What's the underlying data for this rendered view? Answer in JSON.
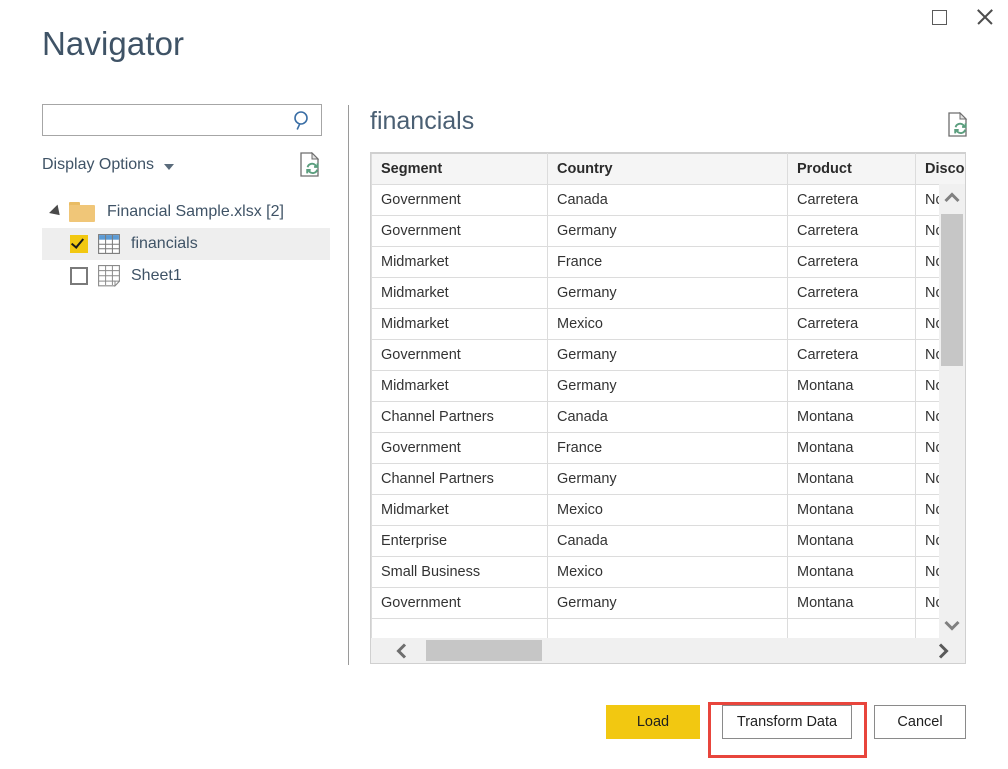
{
  "window": {
    "title": "Navigator",
    "maximize_label": "Maximize",
    "close_label": "Close"
  },
  "sidebar": {
    "search": {
      "value": "",
      "placeholder": "",
      "icon": "search-icon"
    },
    "display_options": {
      "label": "Display Options",
      "caret_icon": "chevron-down-icon"
    },
    "refresh_icon": "refresh-document-icon",
    "tree": [
      {
        "type": "folder",
        "label": "Financial Sample.xlsx [2]",
        "expanded": true,
        "icon": "folder-icon",
        "expander_icon": "expander-triangle-icon"
      },
      {
        "type": "table",
        "label": "financials",
        "checked": true,
        "selected": true,
        "icon": "table-icon",
        "checkbox_icon": "checkbox-checked-icon"
      },
      {
        "type": "sheet",
        "label": "Sheet1",
        "checked": false,
        "selected": false,
        "icon": "sheet-icon",
        "checkbox_icon": "checkbox-unchecked-icon"
      }
    ]
  },
  "preview": {
    "title": "financials",
    "refresh_icon": "refresh-document-icon",
    "columns": [
      "Segment",
      "Country",
      "Product",
      "Discou"
    ],
    "rows": [
      [
        "Government",
        "Canada",
        "Carretera",
        "Nc"
      ],
      [
        "Government",
        "Germany",
        "Carretera",
        "Nc"
      ],
      [
        "Midmarket",
        "France",
        "Carretera",
        "Nc"
      ],
      [
        "Midmarket",
        "Germany",
        "Carretera",
        "Nc"
      ],
      [
        "Midmarket",
        "Mexico",
        "Carretera",
        "Nc"
      ],
      [
        "Government",
        "Germany",
        "Carretera",
        "Nc"
      ],
      [
        "Midmarket",
        "Germany",
        "Montana",
        "Nc"
      ],
      [
        "Channel Partners",
        "Canada",
        "Montana",
        "Nc"
      ],
      [
        "Government",
        "France",
        "Montana",
        "Nc"
      ],
      [
        "Channel Partners",
        "Germany",
        "Montana",
        "Nc"
      ],
      [
        "Midmarket",
        "Mexico",
        "Montana",
        "Nc"
      ],
      [
        "Enterprise",
        "Canada",
        "Montana",
        "Nc"
      ],
      [
        "Small Business",
        "Mexico",
        "Montana",
        "Nc"
      ],
      [
        "Government",
        "Germany",
        "Montana",
        "Nc"
      ],
      [
        "",
        "",
        "",
        ""
      ]
    ],
    "vertical_scrollbar": {
      "up_icon": "chevron-up-icon",
      "down_icon": "chevron-down-icon"
    },
    "horizontal_scrollbar": {
      "left_icon": "chevron-left-icon",
      "right_icon": "chevron-right-icon"
    }
  },
  "footer": {
    "load_label": "Load",
    "transform_label": "Transform Data",
    "cancel_label": "Cancel"
  },
  "colors": {
    "accent_yellow": "#f2c811",
    "annotation_red": "#e8453c",
    "title_blue": "#3f5366",
    "selection_gray": "#eeeeee"
  }
}
